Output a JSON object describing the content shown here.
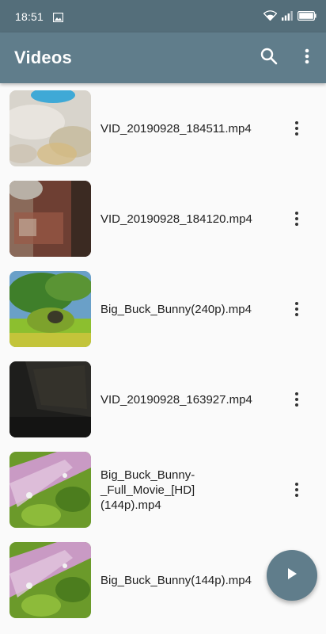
{
  "status_bar": {
    "time": "18:51",
    "left_icons": [
      "image-icon"
    ],
    "right_icons": [
      "wifi-icon",
      "signal-icon",
      "battery-icon"
    ]
  },
  "app_bar": {
    "title": "Videos",
    "actions": [
      "search-icon",
      "overflow-menu-icon"
    ],
    "color": "#607d8b"
  },
  "videos": [
    {
      "name": "VID_20190928_184511.mp4",
      "thumbnail": "bright-floor"
    },
    {
      "name": "VID_20190928_184120.mp4",
      "thumbnail": "red-carpet"
    },
    {
      "name": "Big_Buck_Bunny(240p).mp4",
      "thumbnail": "green-tree"
    },
    {
      "name": "VID_20190928_163927.mp4",
      "thumbnail": "dark-room"
    },
    {
      "name": "Big_Buck_Bunny-_Full_Movie_[HD](144p).mp4",
      "display_lines": [
        "Big_Buck_Bunny-",
        "_Full_Movie_[HD]",
        "(144p).mp4"
      ],
      "thumbnail": "green-path"
    },
    {
      "name": "Big_Buck_Bunny(144p).mp4",
      "thumbnail": "green-path"
    }
  ],
  "fab": {
    "icon": "play-icon"
  }
}
